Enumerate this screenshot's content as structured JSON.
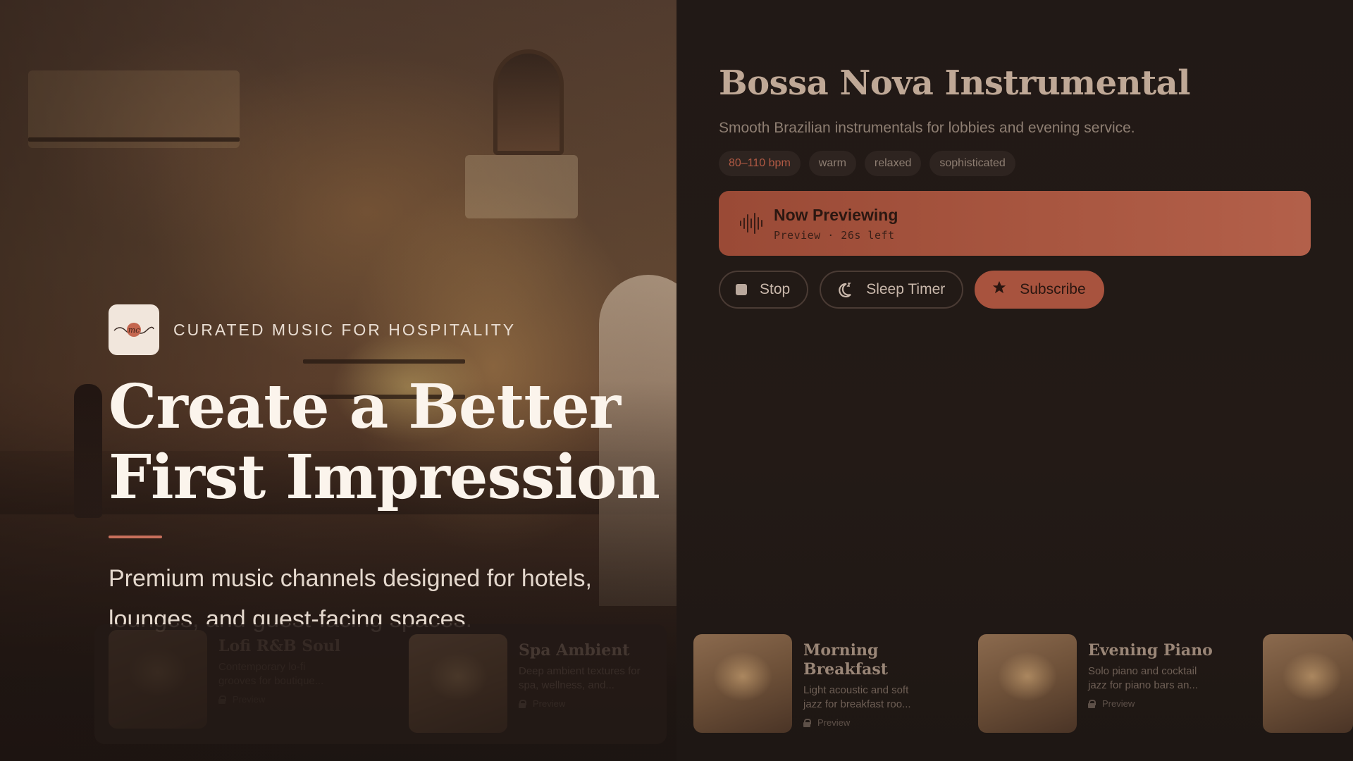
{
  "channel": {
    "title": "Bossa Nova Instrumental",
    "description": "Smooth Brazilian instrumentals for lobbies and evening service.",
    "tags": [
      "80–110 bpm",
      "warm",
      "relaxed",
      "sophisticated"
    ]
  },
  "preview": {
    "label": "Now Previewing",
    "status": "Preview · 26s left",
    "icon": "waveform-icon"
  },
  "controls": {
    "stop_label": "Stop",
    "sleep_label": "Sleep Timer",
    "subscribe_label": "Subscribe"
  },
  "hero": {
    "tagline": "CURATED MUSIC FOR HOSPITALITY",
    "logo_text": "mc",
    "title": "Create a Better First Impression",
    "subtitle": "Premium music channels designed for hotels, lounges, and guest-facing spaces."
  },
  "carousel": [
    {
      "title": "Lofi R&B Soul",
      "description": "Contemporary lo-fi grooves for boutique...",
      "meta": "Preview"
    },
    {
      "title": "Spa Ambient",
      "description": "Deep ambient textures for spa, wellness, and...",
      "meta": "Preview"
    },
    {
      "title": "Morning Breakfast",
      "description": "Light acoustic and soft jazz for breakfast roo...",
      "meta": "Preview"
    },
    {
      "title": "Evening Piano",
      "description": "Solo piano and cocktail jazz for piano bars an...",
      "meta": "Preview"
    }
  ],
  "colors": {
    "accent": "#a8533e",
    "background": "#1c1512",
    "tag_accent": "#b25a44"
  }
}
